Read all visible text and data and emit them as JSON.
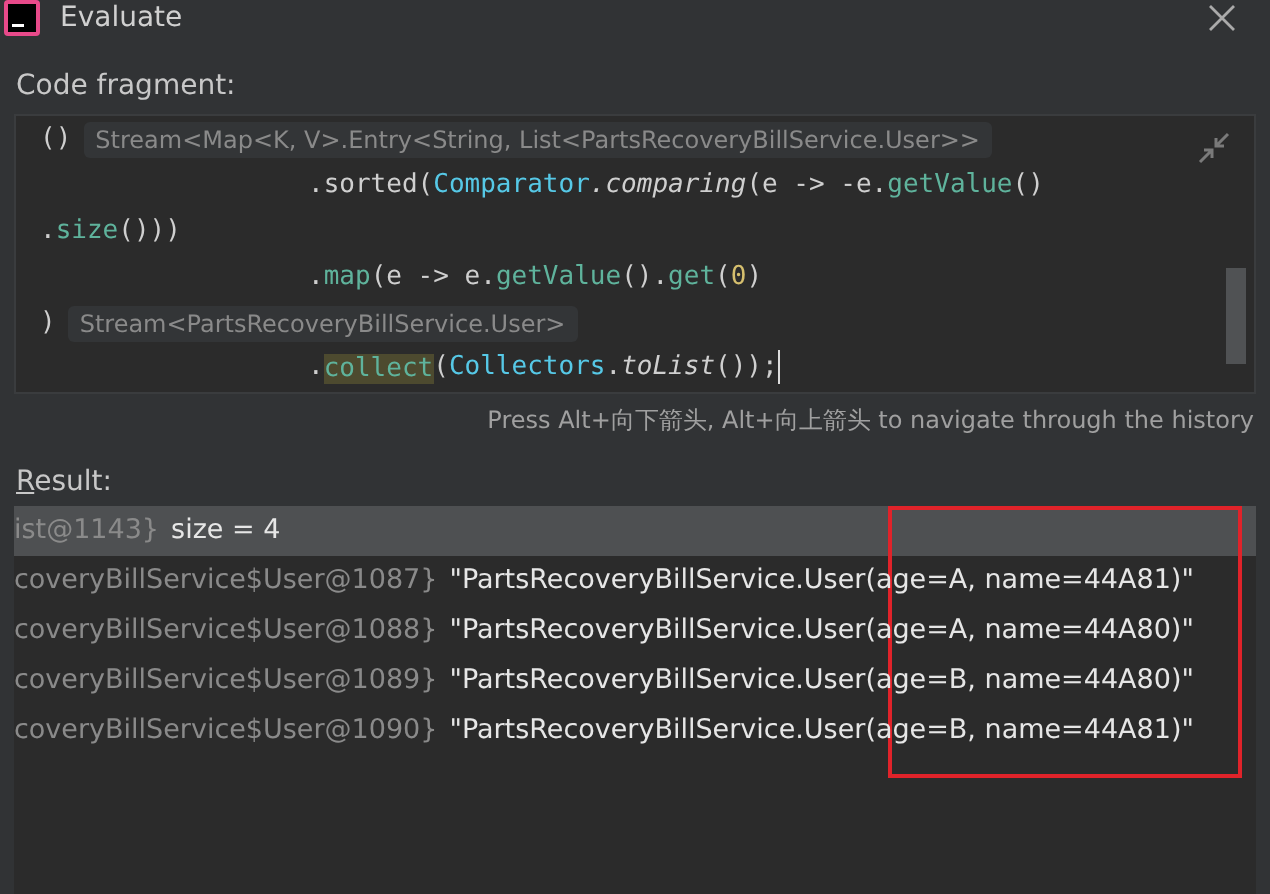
{
  "window": {
    "title": "Evaluate"
  },
  "code_fragment": {
    "label": "Code fragment:",
    "lines": [
      {
        "indent": false,
        "tokens": [
          {
            "kind": "plain",
            "text": "()"
          },
          {
            "kind": "hint",
            "text": "Stream<Map<K, V>.Entry<String, List<PartsRecoveryBillService.User>>"
          }
        ]
      },
      {
        "indent": true,
        "tokens": [
          {
            "kind": "plain",
            "text": ".sorted("
          },
          {
            "kind": "class",
            "text": "Comparator"
          },
          {
            "kind": "italic",
            "text": ".comparing"
          },
          {
            "kind": "plain",
            "text": "(e -> -e."
          },
          {
            "kind": "method",
            "text": "getValue"
          },
          {
            "kind": "plain",
            "text": "()"
          }
        ]
      },
      {
        "indent": false,
        "tokens": [
          {
            "kind": "plain",
            "text": "."
          },
          {
            "kind": "method",
            "text": "size"
          },
          {
            "kind": "plain",
            "text": "()))"
          }
        ]
      },
      {
        "indent": true,
        "tokens": [
          {
            "kind": "plain",
            "text": "."
          },
          {
            "kind": "method",
            "text": "map"
          },
          {
            "kind": "plain",
            "text": "(e -> e."
          },
          {
            "kind": "method",
            "text": "getValue"
          },
          {
            "kind": "plain",
            "text": "()."
          },
          {
            "kind": "method",
            "text": "get"
          },
          {
            "kind": "plain",
            "text": "("
          },
          {
            "kind": "number",
            "text": "0"
          },
          {
            "kind": "plain",
            "text": ")"
          }
        ]
      },
      {
        "indent": false,
        "tokens": [
          {
            "kind": "plain",
            "text": ")"
          },
          {
            "kind": "hint",
            "text": "Stream<PartsRecoveryBillService.User>"
          }
        ]
      },
      {
        "indent": true,
        "tokens": [
          {
            "kind": "plain",
            "text": "."
          },
          {
            "kind": "match",
            "text": "collect"
          },
          {
            "kind": "plain",
            "text": "("
          },
          {
            "kind": "class",
            "text": "Collectors"
          },
          {
            "kind": "plain",
            "text": "."
          },
          {
            "kind": "italic",
            "text": "toList"
          },
          {
            "kind": "plain",
            "text": "());"
          }
        ]
      }
    ],
    "history_hint": "Press Alt+向下箭头, Alt+向上箭头 to navigate through the history"
  },
  "result": {
    "label": "Result:",
    "rows": [
      {
        "name": "ist@1143}",
        "value": "size = 4",
        "selected": true
      },
      {
        "name": "coveryBillService$User@1087}",
        "value": "\"PartsRecoveryBillService.User(age=A, name=44A81)\"",
        "selected": false
      },
      {
        "name": "coveryBillService$User@1088}",
        "value": "\"PartsRecoveryBillService.User(age=A, name=44A80)\"",
        "selected": false
      },
      {
        "name": "coveryBillService$User@1089}",
        "value": "\"PartsRecoveryBillService.User(age=B, name=44A80)\"",
        "selected": false
      },
      {
        "name": "coveryBillService$User@1090}",
        "value": "\"PartsRecoveryBillService.User(age=B, name=44A81)\"",
        "selected": false
      }
    ]
  }
}
